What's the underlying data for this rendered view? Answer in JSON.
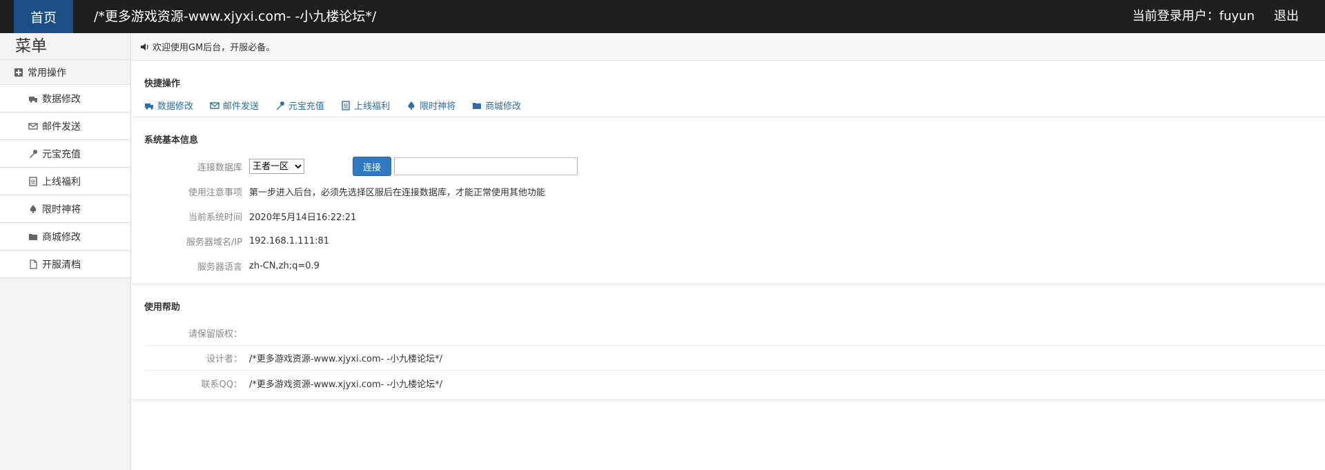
{
  "topbar": {
    "home_label": "首页",
    "site_title": "/*更多游戏资源-www.xjyxi.com- -小九楼论坛*/",
    "user_label": "当前登录用户：fuyun",
    "logout_label": "退出"
  },
  "sidebar": {
    "menu_title": "菜单",
    "group_label": "常用操作",
    "items": [
      {
        "label": "数据修改",
        "icon": "truck-icon"
      },
      {
        "label": "邮件发送",
        "icon": "mail-icon"
      },
      {
        "label": "元宝充值",
        "icon": "wrench-icon"
      },
      {
        "label": "上线福利",
        "icon": "list-icon"
      },
      {
        "label": "限时神将",
        "icon": "spade-icon"
      },
      {
        "label": "商城修改",
        "icon": "folder-icon"
      },
      {
        "label": "开服清档",
        "icon": "file-icon"
      }
    ]
  },
  "notice": {
    "text": "欢迎使用GM后台，开服必备。"
  },
  "quick": {
    "title": "快捷操作",
    "links": [
      {
        "label": "数据修改",
        "icon": "truck-icon"
      },
      {
        "label": "邮件发送",
        "icon": "mail-icon"
      },
      {
        "label": "元宝充值",
        "icon": "wrench-icon"
      },
      {
        "label": "上线福利",
        "icon": "list-icon"
      },
      {
        "label": "限时神将",
        "icon": "spade-icon"
      },
      {
        "label": "商城修改",
        "icon": "folder-icon"
      }
    ]
  },
  "info": {
    "title": "系统基本信息",
    "db_label": "连接数据库",
    "db_selected": "王者一区",
    "connect_label": "连接",
    "note_label": "使用注意事项",
    "note_value": "第一步进入后台，必须先选择区服后在连接数据库，才能正常使用其他功能",
    "time_label": "当前系统时间",
    "time_value": "2020年5月14日16:22:21",
    "server_label": "服务器域名/IP",
    "server_value": "192.168.1.111:81",
    "lang_label": "服务器语言",
    "lang_value": "zh-CN,zh;q=0.9"
  },
  "help": {
    "title": "使用帮助",
    "rows": [
      {
        "label": "请保留版权：",
        "value": ""
      },
      {
        "label": "设计者：",
        "value": "/*更多游戏资源-www.xjyxi.com- -小九楼论坛*/"
      },
      {
        "label": "联系QQ：",
        "value": "/*更多游戏资源-www.xjyxi.com- -小九楼论坛*/"
      }
    ]
  }
}
